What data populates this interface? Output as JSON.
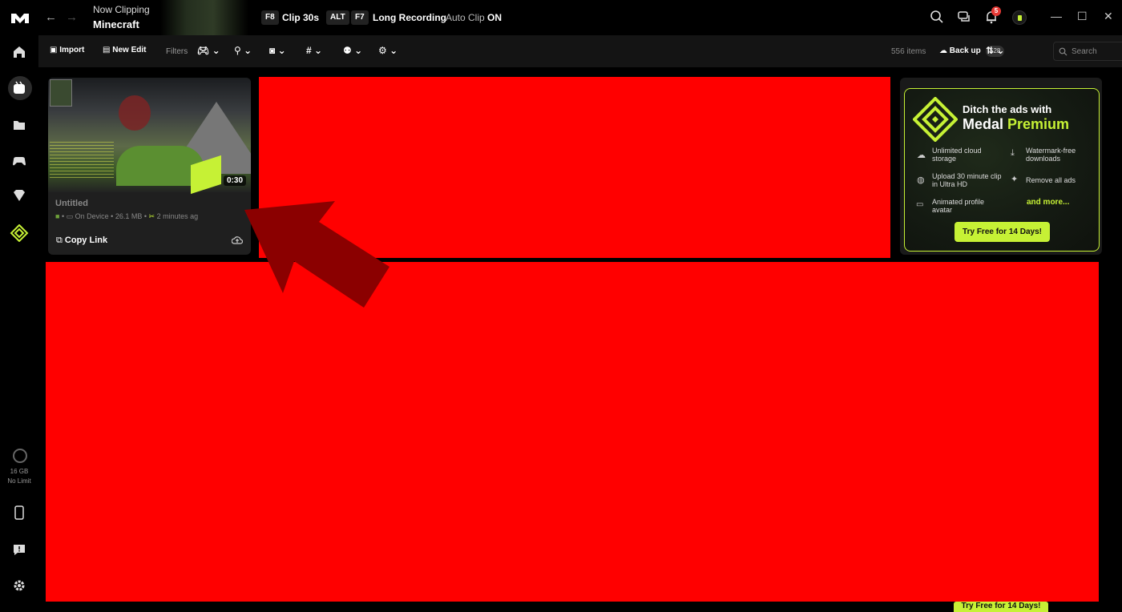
{
  "titlebar": {
    "now_clipping": "Now Clipping",
    "game": "Minecraft",
    "clip_key": "F8",
    "clip_label": "Clip 30s",
    "alt_key": "ALT",
    "rec_key": "F7",
    "rec_label": "Long Recording",
    "autoclip_label": "Auto Clip",
    "autoclip_state": "ON",
    "notif_count": "5"
  },
  "sidebar": {
    "storage_size": "16 GB",
    "storage_limit": "No Limit"
  },
  "toolbar": {
    "import": "Import",
    "new_edit": "New Edit",
    "filters": "Filters",
    "items_count": "556 items",
    "backup": "Back up",
    "backup_count": "528",
    "search_placeholder": "Search"
  },
  "clip": {
    "duration": "0:30",
    "title": "Untitled",
    "location": "On Device",
    "size": "26.1 MB",
    "time": "2 minutes ag",
    "copy_link": "Copy Link"
  },
  "promo": {
    "title_line1": "Ditch the ads with",
    "brand": "Medal",
    "brand_highlight": "Premium",
    "feature_1": "Unlimited cloud storage",
    "feature_2": "Watermark-free downloads",
    "feature_3": "Upload 30 minute clip in Ultra HD",
    "feature_4": "Remove all ads",
    "feature_5": "Animated profile avatar",
    "more": "and more...",
    "cta": "Try Free for 14 Days!"
  },
  "colors": {
    "accent": "#c6f135",
    "redaction": "#ff0000",
    "arrow": "#8b0000"
  }
}
